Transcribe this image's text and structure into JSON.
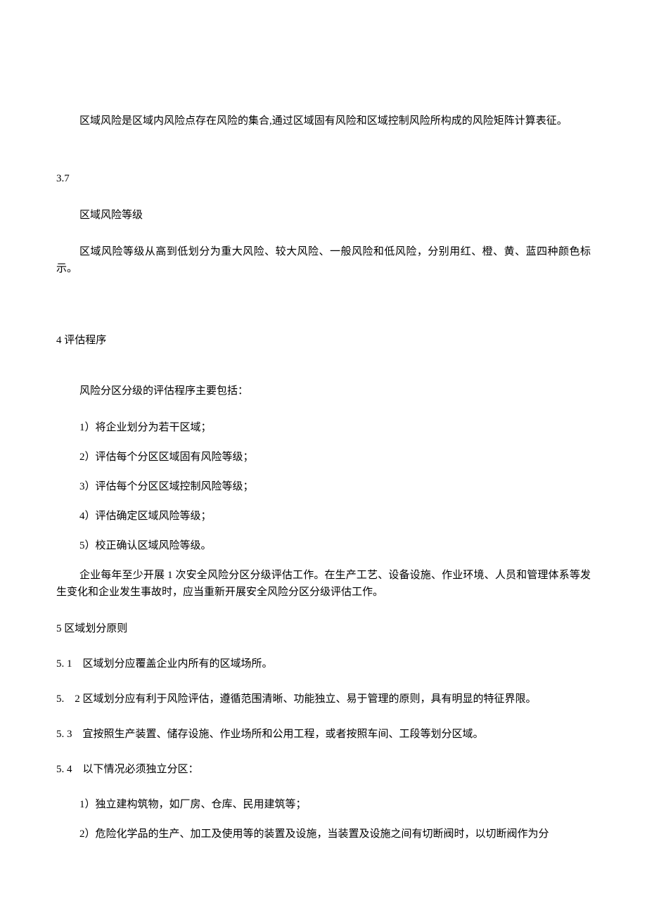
{
  "p1": "区域风险是区域内风险点存在风险的集合,通过区域固有风险和区域控制风险所构成的风险矩阵计算表征。",
  "s37_num": "3.7",
  "s37_title": "区域风险等级",
  "s37_body": "区域风险等级从高到低划分为重大风险、较大风险、一般风险和低风险，分别用红、橙、黄、蓝四种颜色标示。",
  "s4_heading": "4 评估程序",
  "s4_intro": "风险分区分级的评估程序主要包括：",
  "s4_item1": "1）将企业划分为若干区域；",
  "s4_item2": "2）评估每个分区区域固有风险等级；",
  "s4_item3": "3）评估每个分区区域控制风险等级；",
  "s4_item4": "4）评估确定区域风险等级；",
  "s4_item5": "5）校正确认区域风险等级。",
  "s4_para": "企业每年至少开展 1 次安全风险分区分级评估工作。在生产工艺、设备设施、作业环境、人员和管理体系等发生变化和企业发生事故时，应当重新开展安全风险分区分级评估工作。",
  "s5_heading": "5 区域划分原则",
  "s5_1": "5. 1　区域划分应覆盖企业内所有的区域场所。",
  "s5_2": "5.　2 区域划分应有利于风险评估，遵循范围清晰、功能独立、易于管理的原则，具有明显的特征界限。",
  "s5_3": "5. 3　宜按照生产装置、储存设施、作业场所和公用工程，或者按照车间、工段等划分区域。",
  "s5_4": "5. 4　以下情况必须独立分区：",
  "s5_4_item1": "1）独立建构筑物，如厂房、仓库、民用建筑等；",
  "s5_4_item2": "2）危险化学品的生产、加工及使用等的装置及设施，当装置及设施之间有切断阀时，以切断阀作为分"
}
